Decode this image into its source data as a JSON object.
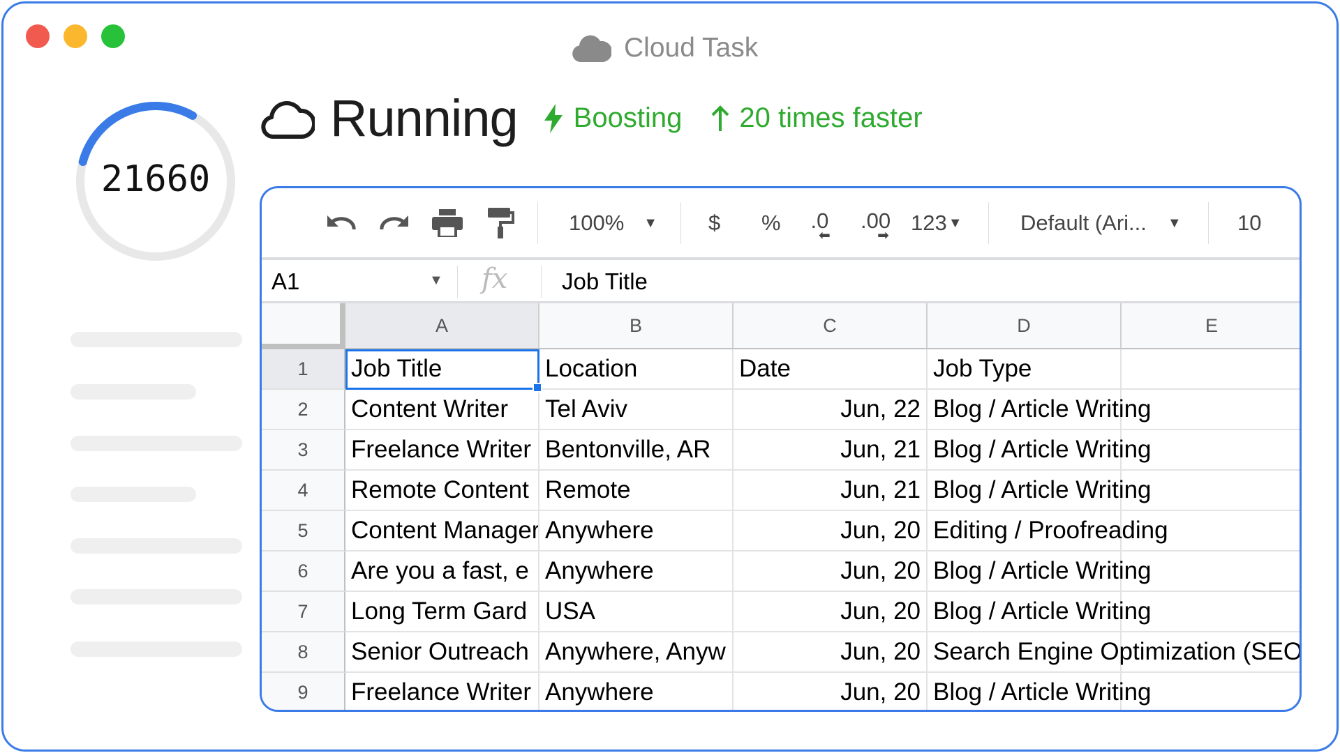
{
  "window": {
    "title": "Cloud Task",
    "accent": "#3b7be8",
    "traffic_lights": [
      "#f05a4f",
      "#fbb72e",
      "#27c23a"
    ]
  },
  "progress": {
    "value": "21660",
    "fraction": 0.29,
    "color": "#3b7be8",
    "track": "#e8e8e8"
  },
  "status": {
    "label": "Running",
    "boost": "Boosting",
    "speed": "20 times faster",
    "green": "#2eaa2e"
  },
  "toolbar": {
    "zoom": "100%",
    "currency": "$",
    "percent": "%",
    "dec_decrease": ".0",
    "dec_increase": ".00",
    "format": "123",
    "font": "Default (Ari...",
    "font_size": "10"
  },
  "formula": {
    "cell_ref": "A1",
    "fx": "fx",
    "value": "Job Title"
  },
  "sheet": {
    "columns": [
      "A",
      "B",
      "C",
      "D",
      "E"
    ],
    "rows": [
      {
        "n": "1",
        "cells": [
          "Job Title",
          "Location",
          "Date",
          "Job Type",
          ""
        ]
      },
      {
        "n": "2",
        "cells": [
          "Content Writer",
          "Tel Aviv",
          "Jun, 22",
          "Blog / Article Writing",
          ""
        ]
      },
      {
        "n": "3",
        "cells": [
          "Freelance Writer",
          "Bentonville, AR",
          "Jun, 21",
          "Blog / Article Writing",
          ""
        ]
      },
      {
        "n": "4",
        "cells": [
          "Remote Content",
          "Remote",
          "Jun, 21",
          "Blog / Article Writing",
          ""
        ]
      },
      {
        "n": "5",
        "cells": [
          "Content Manager",
          "Anywhere",
          "Jun, 20",
          "Editing / Proofreading",
          ""
        ]
      },
      {
        "n": "6",
        "cells": [
          "Are you a fast, e",
          "Anywhere",
          "Jun, 20",
          "Blog / Article Writing",
          ""
        ]
      },
      {
        "n": "7",
        "cells": [
          "Long Term Gard",
          "USA",
          "Jun, 20",
          "Blog / Article Writing",
          ""
        ]
      },
      {
        "n": "8",
        "cells": [
          "Senior Outreach",
          "Anywhere, Anyw",
          "Jun, 20",
          "Search Engine Optimization (SEO)",
          ""
        ]
      },
      {
        "n": "9",
        "cells": [
          "Freelance Writer",
          "Anywhere",
          "Jun, 20",
          "Blog / Article Writing",
          ""
        ]
      }
    ]
  }
}
